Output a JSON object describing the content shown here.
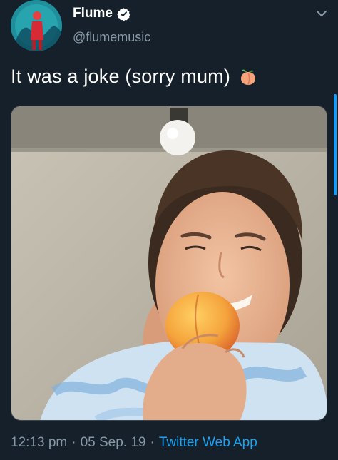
{
  "author": {
    "display_name": "Flume",
    "handle": "@flumemusic",
    "verified": true
  },
  "tweet": {
    "text": "It was a joke (sorry mum)",
    "emoji": "peach"
  },
  "meta": {
    "time": "12:13 pm",
    "date": "05 Sep. 19",
    "separator": "·",
    "source": "Twitter Web App"
  },
  "icons": {
    "verified": "verified-badge-icon",
    "menu": "chevron-down-icon",
    "emoji": "peach-emoji-icon"
  },
  "colors": {
    "background": "#15202b",
    "secondary_text": "#8899a6",
    "link": "#1da1f2"
  }
}
